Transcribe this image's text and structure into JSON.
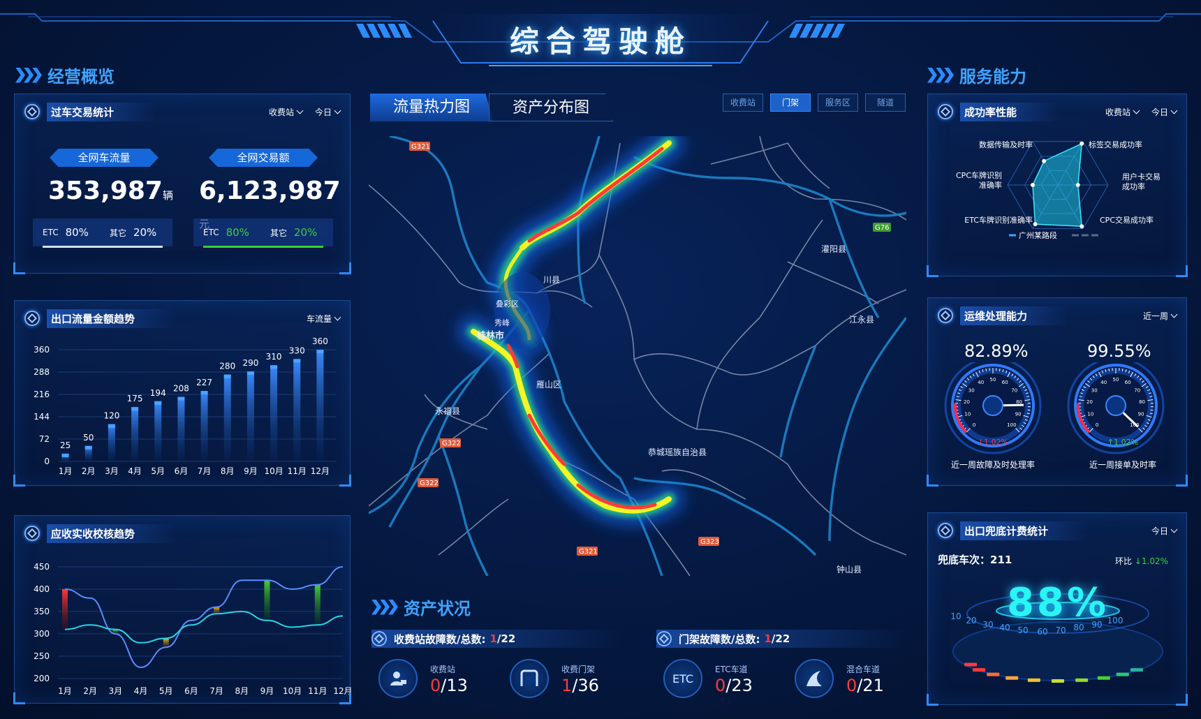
{
  "title": "综合驾驶舱",
  "left_section": {
    "title": "经营概览"
  },
  "right_section": {
    "title": "服务能力"
  },
  "txn": {
    "title": "过车交易统计",
    "filter1": "收费站",
    "filter2": "今日",
    "flow_label": "全网车流量",
    "flow_value": "353,987",
    "flow_unit": "辆",
    "amount_label": "全网交易额",
    "amount_value": "6,123,987",
    "amount_unit": "元",
    "flow_etc_label": "ETC",
    "flow_etc_value": "80%",
    "flow_other_label": "其它",
    "flow_other_value": "20%",
    "amt_etc_label": "ETC",
    "amt_etc_value": "80%",
    "amt_other_label": "其它",
    "amt_other_value": "20%"
  },
  "exit_trend": {
    "title": "出口流量金额趋势",
    "filter": "车流量"
  },
  "recv_trend": {
    "title": "应收实收校核趋势"
  },
  "map": {
    "tab_heat": "流量热力图",
    "tab_asset": "资产分布图",
    "btn_toll": "收费站",
    "btn_gantry": "门架",
    "btn_service": "服务区",
    "btn_tunnel": "隧道",
    "labels": {
      "guilin": "桂林市",
      "xiufeng": "秀峰",
      "diecai": "叠彩区",
      "yanshan": "雁山区",
      "yongfu": "永福县",
      "gongcheng": "恭城瑶族自治县",
      "guanyang": "灌阳县",
      "jiangyong": "江永县",
      "lingchuan": "川县",
      "zhongshan": "钟山县",
      "road_g321_a": "G321",
      "road_g321_b": "G321",
      "road_g322_a": "G322",
      "road_g322_b": "G322",
      "road_g323": "G323",
      "road_g76": "G76"
    }
  },
  "asset": {
    "title": "资产状况",
    "toll_fault_title": "收费站故障数/总数:",
    "toll_fault_num": "1",
    "toll_fault_total": "/22",
    "gantry_fault_title": "门架故障数/总数:",
    "gantry_fault_num": "1",
    "gantry_fault_total": "/22",
    "items": [
      {
        "label": "收费站",
        "num": "0",
        "total": "/13"
      },
      {
        "label": "收费门架",
        "num": "1",
        "total": "/36"
      },
      {
        "label": "ETC车道",
        "num": "0",
        "total": "/23"
      },
      {
        "label": "混合车道",
        "num": "0",
        "total": "/21"
      }
    ],
    "etc_icon_text": "ETC"
  },
  "success": {
    "title": "成功率性能",
    "filter1": "收费站",
    "filter2": "今日",
    "axes": [
      "标签交易成功率",
      "用户卡交易成功率",
      "CPC交易成功率",
      "ETC车牌识别准确率",
      "CPC车牌识别准确率",
      "数据传输及时率"
    ],
    "legend": "广州某路段"
  },
  "ops": {
    "title": "运维处理能力",
    "filter": "近一周",
    "g1_value": "82.89%",
    "g1_change": "↓1.02%",
    "g1_label": "近一周故障及时处理率",
    "g2_value": "99.55%",
    "g2_change": "↑1.02%",
    "g2_label": "近一周接单及时率",
    "ticks": [
      "0",
      "10",
      "20",
      "30",
      "40",
      "50",
      "60",
      "70",
      "80",
      "90",
      "100"
    ]
  },
  "fallback": {
    "title": "出口兜底计费统计",
    "filter": "今日",
    "count_label": "兜底车次：",
    "count_value": "211",
    "ratio_label": "环比",
    "ratio_value": "↓1.02%",
    "percent": "88%",
    "scale": [
      "10",
      "20",
      "30",
      "40",
      "50",
      "60",
      "70",
      "80",
      "90",
      "100"
    ]
  },
  "colors": {
    "accent": "#2e8bff",
    "bg": "#041331",
    "red": "#ff3a3a",
    "green": "#3ad13a"
  },
  "chart_data": [
    {
      "type": "bar",
      "categories": [
        "1月",
        "2月",
        "3月",
        "4月",
        "5月",
        "6月",
        "7月",
        "8月",
        "9月",
        "10月",
        "11月",
        "12月"
      ],
      "values": [
        25,
        50,
        120,
        175,
        194,
        208,
        227,
        280,
        290,
        310,
        330,
        360
      ],
      "yticks": [
        0,
        72,
        144,
        216,
        288,
        360
      ],
      "ylim": [
        0,
        360
      ]
    },
    {
      "type": "line",
      "categories": [
        "1月",
        "2月",
        "3月",
        "4月",
        "5月",
        "6月",
        "7月",
        "8月",
        "9月",
        "10月",
        "11月",
        "12月"
      ],
      "yticks": [
        200,
        250,
        300,
        350,
        400,
        450
      ],
      "ylim": [
        200,
        450
      ],
      "series": [
        {
          "values": [
            400,
            380,
            300,
            225,
            270,
            330,
            360,
            420,
            420,
            400,
            410,
            450
          ]
        },
        {
          "values": [
            310,
            320,
            310,
            280,
            290,
            320,
            345,
            350,
            330,
            315,
            320,
            340
          ]
        }
      ]
    },
    {
      "type": "radar",
      "axes": [
        "标签交易成功率",
        "用户卡交易成功率",
        "CPC交易成功率",
        "ETC车牌识别准确率",
        "CPC车牌识别准确率",
        "数据传输及时率"
      ],
      "series": [
        {
          "name": "广州某路段",
          "values": [
            0.95,
            0.4,
            0.95,
            0.9,
            0.5,
            0.55
          ]
        }
      ]
    }
  ]
}
